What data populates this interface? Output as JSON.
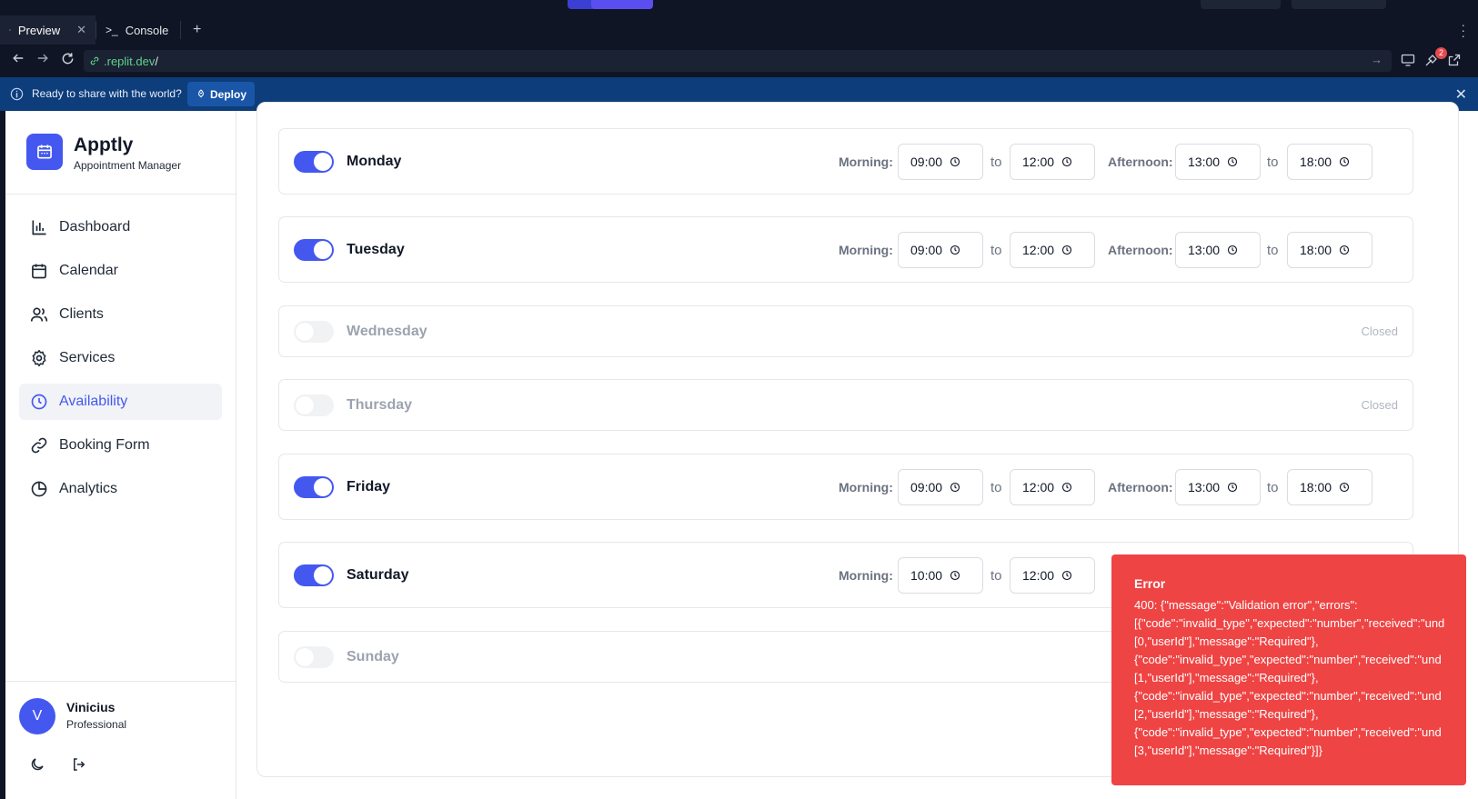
{
  "browser": {
    "tabs": [
      {
        "label": "Preview",
        "active": true
      },
      {
        "label": "Console",
        "active": false
      }
    ],
    "url_host": ".replit.dev",
    "url_path": "/",
    "notification_count": "2"
  },
  "banner": {
    "message": "Ready to share with the world?",
    "deploy_label": "Deploy"
  },
  "app": {
    "name": "Apptly",
    "subtitle": "Appointment Manager",
    "accent_color": "#4458f0"
  },
  "sidebar": {
    "items": [
      {
        "label": "Dashboard",
        "icon": "bar-chart-icon",
        "active": false
      },
      {
        "label": "Calendar",
        "icon": "calendar-icon",
        "active": false
      },
      {
        "label": "Clients",
        "icon": "users-icon",
        "active": false
      },
      {
        "label": "Services",
        "icon": "gear-icon",
        "active": false
      },
      {
        "label": "Availability",
        "icon": "clock-icon",
        "active": true
      },
      {
        "label": "Booking Form",
        "icon": "link-icon",
        "active": false
      },
      {
        "label": "Analytics",
        "icon": "pie-chart-icon",
        "active": false
      }
    ]
  },
  "user": {
    "initial": "V",
    "name": "Vinicius",
    "role": "Professional"
  },
  "schedule": {
    "morning_label": "Morning:",
    "afternoon_label": "Afternoon:",
    "to_label": "to",
    "closed_label": "Closed",
    "days": [
      {
        "name": "Monday",
        "enabled": true,
        "morning_start": "09:00",
        "morning_end": "12:00",
        "afternoon_start": "13:00",
        "afternoon_end": "18:00"
      },
      {
        "name": "Tuesday",
        "enabled": true,
        "morning_start": "09:00",
        "morning_end": "12:00",
        "afternoon_start": "13:00",
        "afternoon_end": "18:00"
      },
      {
        "name": "Wednesday",
        "enabled": false
      },
      {
        "name": "Thursday",
        "enabled": false
      },
      {
        "name": "Friday",
        "enabled": true,
        "morning_start": "09:00",
        "morning_end": "12:00",
        "afternoon_start": "13:00",
        "afternoon_end": "18:00"
      },
      {
        "name": "Saturday",
        "enabled": true,
        "morning_start": "10:00",
        "morning_end": "12:00"
      },
      {
        "name": "Sunday",
        "enabled": false
      }
    ]
  },
  "toast": {
    "title": "Error",
    "lines": [
      "400: {\"message\":\"Validation error\",\"errors\":",
      "[{\"code\":\"invalid_type\",\"expected\":\"number\",\"received\":\"und",
      "[0,\"userId\"],\"message\":\"Required\"},",
      "{\"code\":\"invalid_type\",\"expected\":\"number\",\"received\":\"und",
      "[1,\"userId\"],\"message\":\"Required\"},",
      "{\"code\":\"invalid_type\",\"expected\":\"number\",\"received\":\"und",
      "[2,\"userId\"],\"message\":\"Required\"},",
      "{\"code\":\"invalid_type\",\"expected\":\"number\",\"received\":\"und",
      "[3,\"userId\"],\"message\":\"Required\"}]}"
    ],
    "color": "#ef4444"
  }
}
